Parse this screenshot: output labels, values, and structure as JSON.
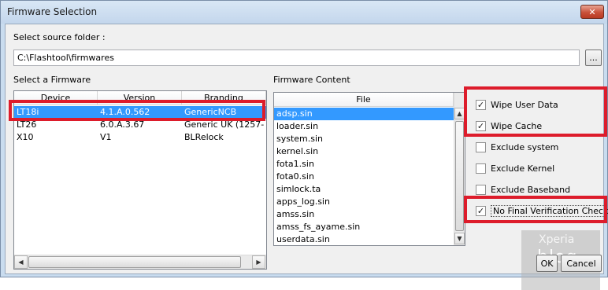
{
  "window": {
    "title": "Firmware Selection",
    "close_label": "✕"
  },
  "source": {
    "label": "Select source folder :",
    "path": "C:\\Flashtool\\firmwares",
    "browse_label": "..."
  },
  "firmware_list": {
    "label": "Select a Firmware",
    "columns": [
      "Device",
      "Version",
      "Branding"
    ],
    "rows": [
      {
        "device": "LT18i",
        "version": "4.1.A.0.562",
        "branding": "GenericNCB",
        "selected": true
      },
      {
        "device": "LT26",
        "version": "6.0.A.3.67",
        "branding": "Generic UK (1257-",
        "selected": false
      },
      {
        "device": "X10",
        "version": "V1",
        "branding": "BLRelock",
        "selected": false
      }
    ]
  },
  "content": {
    "label": "Firmware Content",
    "column": "File",
    "files": [
      "adsp.sin",
      "loader.sin",
      "system.sin",
      "kernel.sin",
      "fota1.sin",
      "fota0.sin",
      "simlock.ta",
      "apps_log.sin",
      "amss.sin",
      "amss_fs_ayame.sin",
      "userdata.sin"
    ],
    "selected_index": 0
  },
  "options": [
    {
      "label": "Wipe User Data",
      "checked": true
    },
    {
      "label": "Wipe Cache",
      "checked": true
    },
    {
      "label": "Exclude system",
      "checked": false
    },
    {
      "label": "Exclude Kernel",
      "checked": false
    },
    {
      "label": "Exclude Baseband",
      "checked": false
    },
    {
      "label": "No Final Verification Check",
      "checked": true
    }
  ],
  "buttons": {
    "ok": "OK",
    "cancel": "Cancel"
  },
  "watermark": {
    "brand": "Xperia",
    "word": "blog"
  },
  "colors": {
    "selection": "#3399ff",
    "highlight": "#dd1c2b"
  }
}
